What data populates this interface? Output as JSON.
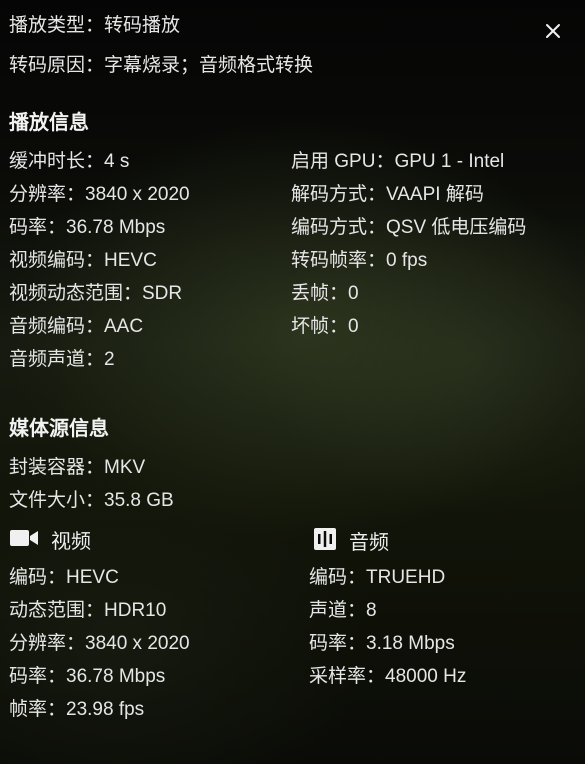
{
  "top": {
    "play_type": "播放类型：转码播放",
    "reason": "转码原因：字幕烧录；音频格式转换"
  },
  "playback": {
    "title": "播放信息",
    "left": [
      "缓冲时长：4 s",
      "分辨率：3840 x 2020",
      "码率：36.78 Mbps",
      "视频编码：HEVC",
      "视频动态范围：SDR",
      "音频编码：AAC",
      "音频声道：2"
    ],
    "right": [
      "启用 GPU：GPU 1 - Intel",
      "解码方式：VAAPI 解码",
      "编码方式：QSV 低电压编码",
      "转码帧率：0 fps",
      "丢帧：0",
      "坏帧：0"
    ]
  },
  "media": {
    "title": "媒体源信息",
    "container": "封装容器：MKV",
    "size": "文件大小：35.8 GB",
    "video": {
      "title": "视频",
      "icon": "video-camera-icon",
      "rows": [
        "编码：HEVC",
        "动态范围：HDR10",
        "分辨率：3840 x 2020",
        "码率：36.78 Mbps",
        "帧率：23.98 fps"
      ]
    },
    "audio": {
      "title": "音频",
      "icon": "audio-wave-icon",
      "rows": [
        "编码：TRUEHD",
        "声道：8",
        "码率：3.18 Mbps",
        "采样率：48000 Hz"
      ]
    }
  },
  "colors": {
    "text": "#e6e6e6",
    "background": "#0b0c08"
  }
}
